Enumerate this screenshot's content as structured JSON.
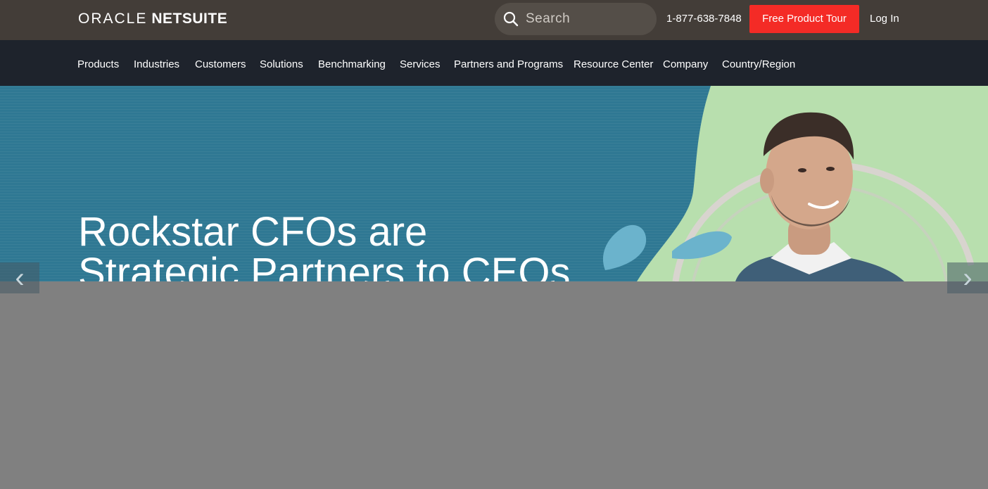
{
  "header": {
    "logo_oracle": "ORACLE",
    "logo_netsuite": "NETSUITE",
    "search_placeholder": "Search",
    "phone": "1-877-638-7848",
    "tour_button": "Free Product Tour",
    "login": "Log In"
  },
  "nav": {
    "items": [
      "Products",
      "Industries",
      "Customers",
      "Solutions",
      "Benchmarking",
      "Services",
      "Partners and Programs",
      "Resource Center",
      "Company",
      "Country/Region"
    ]
  },
  "hero": {
    "title_line1": "Rockstar CFOs are",
    "title_line2": "Strategic Partners to CEOs"
  },
  "carousel": {
    "prev_icon": "chevron-left-icon",
    "next_icon": "chevron-right-icon"
  },
  "colors": {
    "topbar": "#433d38",
    "nav": "#1e232c",
    "cta": "#f42b26",
    "hero": "#2f7893"
  }
}
